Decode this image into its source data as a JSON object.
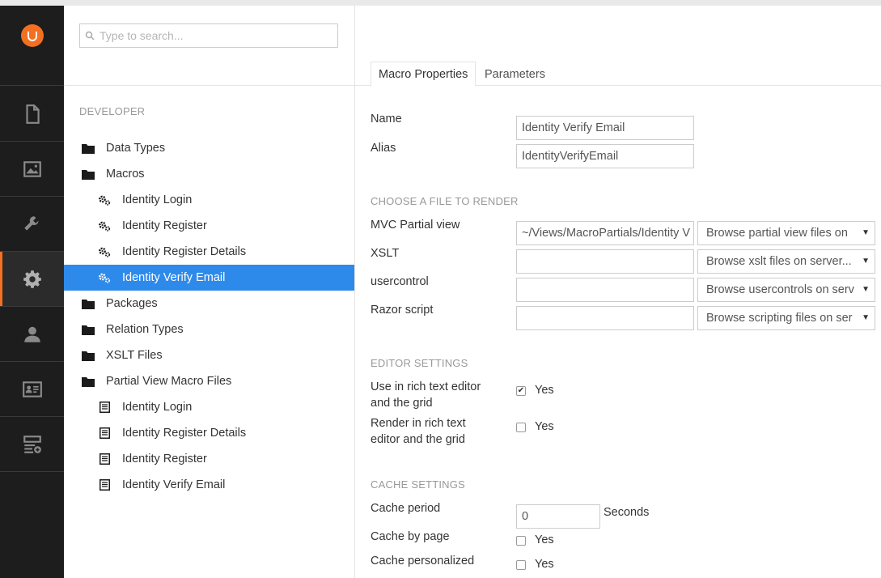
{
  "search": {
    "placeholder": "Type to search..."
  },
  "nav": {
    "logo": "umbraco-logo",
    "items": [
      {
        "icon": "document-icon"
      },
      {
        "icon": "image-icon"
      },
      {
        "icon": "wrench-icon"
      },
      {
        "icon": "gear-icon",
        "active": true
      },
      {
        "icon": "user-icon"
      },
      {
        "icon": "id-card-icon"
      },
      {
        "icon": "forms-icon"
      }
    ]
  },
  "tree": {
    "section": "DEVELOPER",
    "items": [
      {
        "label": "Data Types",
        "icon": "folder-icon",
        "level": 1
      },
      {
        "label": "Macros",
        "icon": "folder-icon",
        "level": 1
      },
      {
        "label": "Identity Login",
        "icon": "cogs-icon",
        "level": 2
      },
      {
        "label": "Identity Register",
        "icon": "cogs-icon",
        "level": 2
      },
      {
        "label": "Identity Register Details",
        "icon": "cogs-icon",
        "level": 2
      },
      {
        "label": "Identity Verify Email",
        "icon": "cogs-icon",
        "level": 2,
        "selected": true
      },
      {
        "label": "Packages",
        "icon": "folder-icon",
        "level": 1
      },
      {
        "label": "Relation Types",
        "icon": "folder-icon",
        "level": 1
      },
      {
        "label": "XSLT Files",
        "icon": "folder-icon",
        "level": 1
      },
      {
        "label": "Partial View Macro Files",
        "icon": "folder-icon",
        "level": 1
      },
      {
        "label": "Identity Login",
        "icon": "file-icon",
        "level": 2
      },
      {
        "label": "Identity Register Details",
        "icon": "file-icon",
        "level": 2
      },
      {
        "label": "Identity Register",
        "icon": "file-icon",
        "level": 2
      },
      {
        "label": "Identity Verify Email",
        "icon": "file-icon",
        "level": 2
      }
    ]
  },
  "tabs": {
    "properties": "Macro Properties",
    "parameters": "Parameters"
  },
  "form": {
    "name_label": "Name",
    "name_value": "Identity Verify Email",
    "alias_label": "Alias",
    "alias_value": "IdentityVerifyEmail",
    "file_section": "CHOOSE A FILE TO RENDER",
    "mvc_label": "MVC Partial view",
    "mvc_value": "~/Views/MacroPartials/Identity V",
    "mvc_browse": "Browse partial view files on",
    "xslt_label": "XSLT",
    "xslt_value": "",
    "xslt_browse": "Browse xslt files on server...",
    "uc_label": "usercontrol",
    "uc_value": "",
    "uc_browse": "Browse usercontrols on serv",
    "razor_label": "Razor script",
    "razor_value": "",
    "razor_browse": "Browse scripting files on ser",
    "editor_section": "EDITOR SETTINGS",
    "use_rte_label_1": "Use in rich text editor",
    "use_rte_label_2": "and the grid",
    "use_rte_yes": "Yes",
    "use_rte_checked": true,
    "render_rte_label_1": "Render in rich text",
    "render_rte_label_2": "editor and the grid",
    "render_rte_yes": "Yes",
    "render_rte_checked": false,
    "cache_section": "CACHE SETTINGS",
    "cache_period_label": "Cache period",
    "cache_period_value": "0",
    "cache_period_unit": "Seconds",
    "cache_page_label": "Cache by page",
    "cache_page_yes": "Yes",
    "cache_personal_label": "Cache personalized",
    "cache_personal_yes": "Yes"
  }
}
